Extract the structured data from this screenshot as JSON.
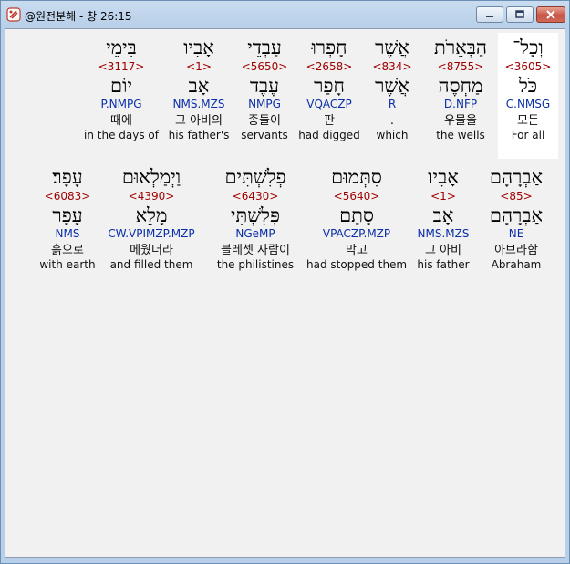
{
  "window": {
    "title": "@원전분해 - 창 26:15"
  },
  "rows": [
    [
      {
        "hebrew": "וְכָל־",
        "strong": "<3605>",
        "lemma": "כֹּל",
        "morph": "C.NMSG",
        "korean": "모든",
        "english": "For all",
        "selected": true
      },
      {
        "hebrew": "הַבְּאֵרֹת",
        "strong": "<8755>",
        "lemma": "מַחְסֶה",
        "morph": "D.NFP",
        "korean": "우물을",
        "english": "the wells"
      },
      {
        "hebrew": "אֲשֶׁר",
        "strong": "<834>",
        "lemma": "אֲשֶׁר",
        "morph": "R",
        "korean": "",
        "english": "which",
        "korean_dot": "."
      },
      {
        "hebrew": "חָפְרוּ",
        "strong": "<2658>",
        "lemma": "חָפַר",
        "morph": "VQACZP",
        "korean": "판",
        "english": "had digged"
      },
      {
        "hebrew": "עַבְדֵי",
        "strong": "<5650>",
        "lemma": "עֶבֶד",
        "morph": "NMPG",
        "korean": "종들이",
        "english": "servants"
      },
      {
        "hebrew": "אָבִיו",
        "strong": "<1>",
        "lemma": "אָב",
        "morph": "NMS.MZS",
        "korean": "그 아비의",
        "english": "his father's"
      },
      {
        "hebrew": "בִּימֵי",
        "strong": "<3117>",
        "lemma": "יוֹם",
        "morph": "P.NMPG",
        "korean": "때에",
        "english": "in the days of"
      }
    ],
    [
      {
        "hebrew": "אַבְרָהָם",
        "strong": "<85>",
        "lemma": "אַבְרָהָם",
        "morph": "NE",
        "korean": "아브라함",
        "english": "Abraham"
      },
      {
        "hebrew": "אָבִיו",
        "strong": "<1>",
        "lemma": "אָב",
        "morph": "NMS.MZS",
        "korean": "그 아비",
        "english": "his father"
      },
      {
        "hebrew": "סִתְּמוּם",
        "strong": "<5640>",
        "lemma": "סָתַם",
        "morph": "VPACZP.MZP",
        "korean": "막고",
        "english": "had stopped them"
      },
      {
        "hebrew": "פְלִשְׁתִּים",
        "strong": "<6430>",
        "lemma": "פְּלִשְׁתִּי",
        "morph": "NGeMP",
        "korean": "블레셋 사람이",
        "english": "the philistines"
      },
      {
        "hebrew": "וַיְמַלְאוּם",
        "strong": "<4390>",
        "lemma": "מָלֵא",
        "morph": "CW.VPIMZP.MZP",
        "korean": "메웠더라",
        "english": "and filled them"
      },
      {
        "hebrew": "עָפָר׃",
        "strong": "<6083>",
        "lemma": "עָפָר",
        "morph": "NMS",
        "korean": "흙으로",
        "english": "with earth"
      }
    ]
  ]
}
